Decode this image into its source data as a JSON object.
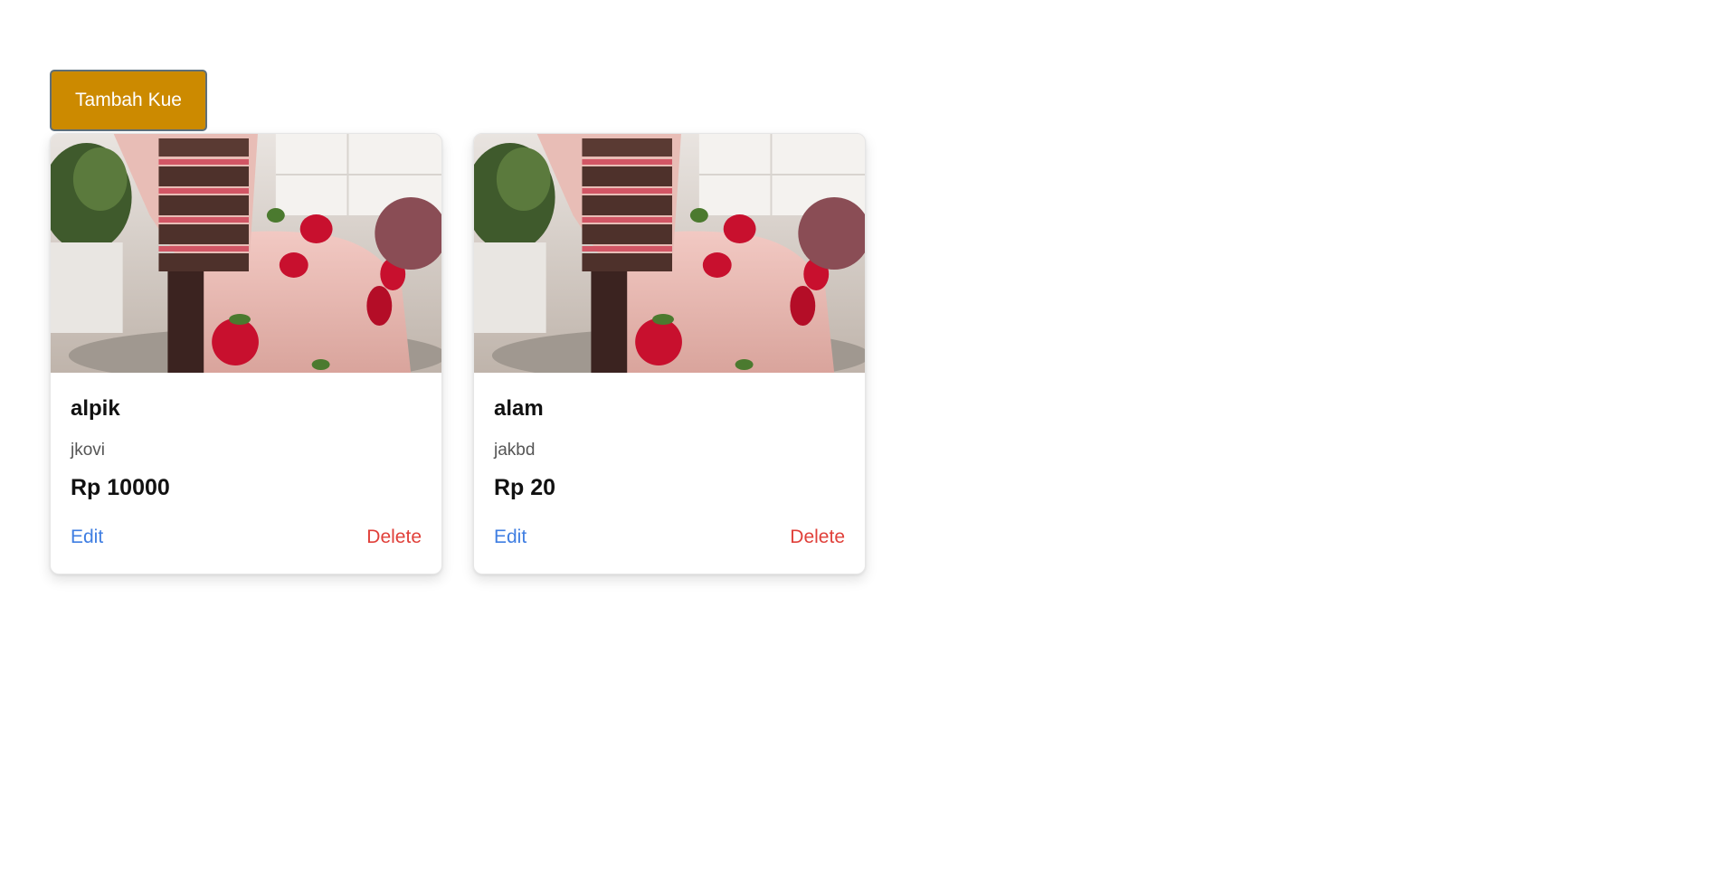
{
  "toolbar": {
    "add_label": "Tambah Kue",
    "add_color": "#cc8a00"
  },
  "cards": [
    {
      "image_icon": "cake-photo",
      "name": "alpik",
      "description": "jkovi",
      "price": "Rp 10000",
      "edit_label": "Edit",
      "delete_label": "Delete"
    },
    {
      "image_icon": "cake-photo",
      "name": "alam",
      "description": "jakbd",
      "price": "Rp 20",
      "edit_label": "Edit",
      "delete_label": "Delete"
    }
  ],
  "colors": {
    "edit": "#3f7ee2",
    "delete": "#e0403a"
  }
}
